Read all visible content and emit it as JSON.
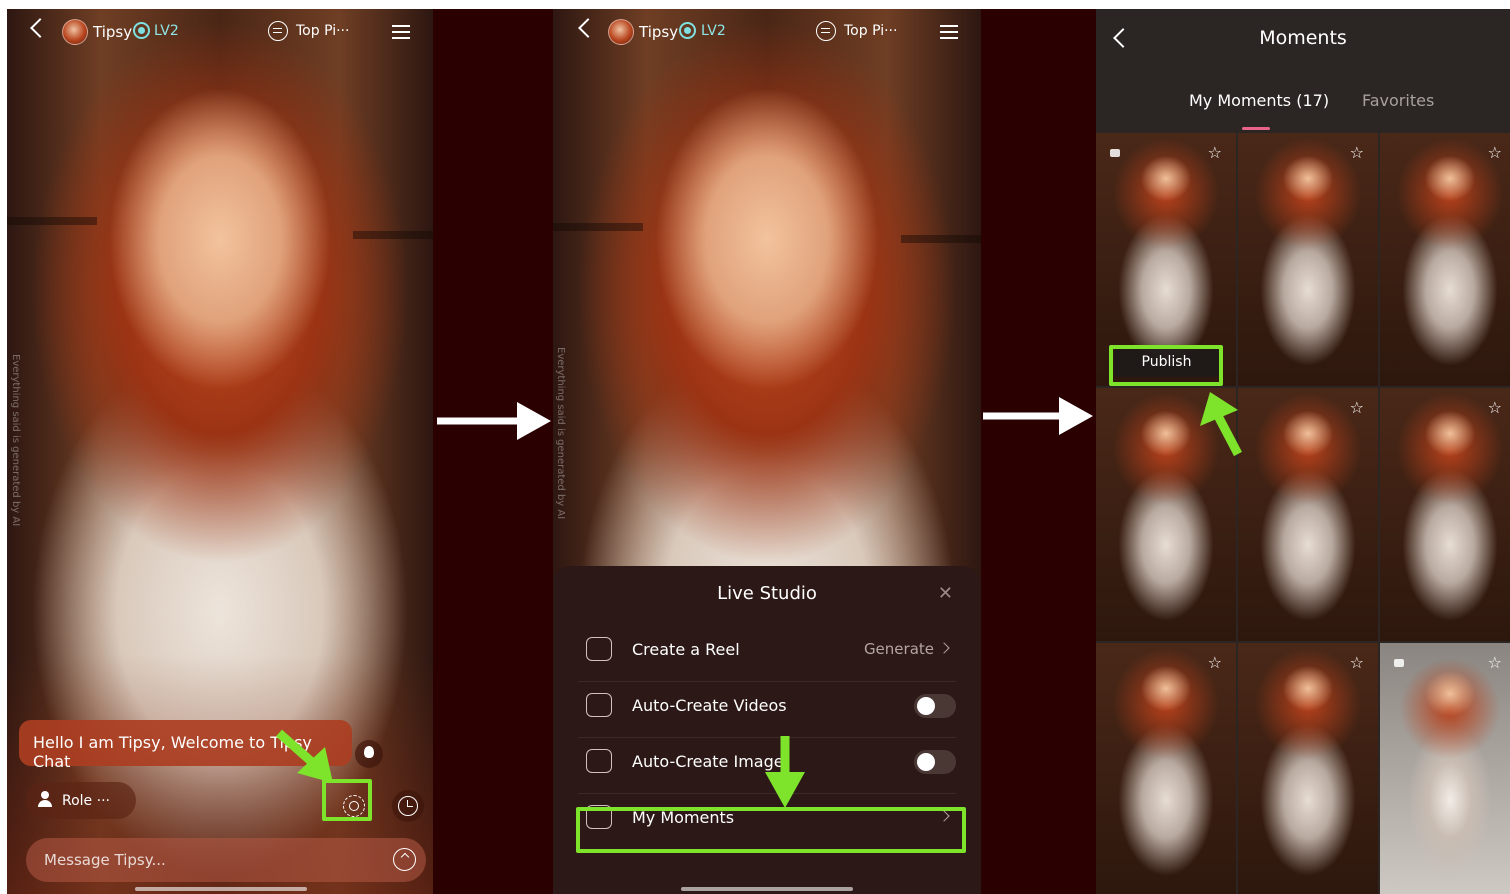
{
  "chat_screen": {
    "character_name": "Tipsy",
    "level": "LV2",
    "top_pick": "Top Pi···",
    "watermark": "Everything said is generated by AI",
    "greeting": "Hello I am Tipsy, Welcome to Tipsy Chat",
    "role_label": "Role ···",
    "message_placeholder": "Message Tipsy..."
  },
  "studio_screen": {
    "character_name": "Tipsy",
    "level": "LV2",
    "top_pick": "Top Pi···",
    "watermark": "Everything said is generated by AI",
    "sheet": {
      "title": "Live Studio",
      "close": "✕",
      "rows": [
        {
          "label": "Create a Reel",
          "value": "Generate",
          "control": "chevron"
        },
        {
          "label": "Auto-Create Videos",
          "control": "toggle",
          "on": false
        },
        {
          "label": "Auto-Create Image",
          "control": "toggle",
          "on": false
        },
        {
          "label": "My Moments",
          "control": "chevron"
        }
      ]
    }
  },
  "moments_screen": {
    "title": "Moments",
    "tabs": [
      {
        "label": "My Moments (17)",
        "active": true
      },
      {
        "label": "Favorites",
        "active": false
      }
    ],
    "publish_label": "Publish",
    "star_glyph": "☆"
  },
  "colors": {
    "highlight": "#7ee32b",
    "accent_underline": "#e9648a",
    "bubble": "#ab3e22",
    "sheet_bg": "#2c1816",
    "moments_bg": "#2b2523"
  }
}
